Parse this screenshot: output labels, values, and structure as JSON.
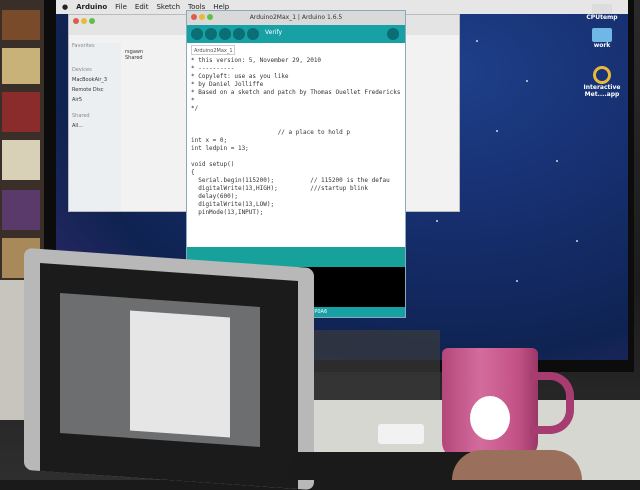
{
  "menubar": {
    "app": "Arduino",
    "items": [
      "File",
      "Edit",
      "Sketch",
      "Tools",
      "Help"
    ]
  },
  "finder": {
    "sidebar": [
      "Favorites",
      "Devices",
      "MacBookAir_3",
      "Remote Disc",
      "Air5",
      "Shared",
      "All..."
    ],
    "list": [
      "rsgawn",
      "Shared"
    ]
  },
  "arduino": {
    "title": "Arduino2Max_1 | Arduino 1.6.5",
    "verify_label": "Verify",
    "tab": "Arduino2Max_1",
    "code": "* this version: 5, November 29, 2010\n* ----------\n* Copyleft: use as you like\n* by Daniel Jolliffe\n* Based on a sketch and patch by Thomas Ouellet Fredericks\n*\n*/\n\n\n                        // a place to hold p\nint x = 0;\nint ledpin = 13;\n\nvoid setup()\n{\n  Serial.begin(115200);          // 115200 is the defau\n  digitalWrite(13,HIGH);         ///startup blink\n  delay(600);\n  digitalWrite(13,LOW);\n  pinMode(13,INPUT);",
    "status": "ino Nano, ATmega328 on /dev/cu.usbserial-1BQNP0A6"
  },
  "desktop_icons": [
    "CPUtemp",
    "work",
    "Interactive Met....app"
  ],
  "colors": {
    "arduino_teal": "#17a1a5",
    "desktop_blue": "#152d6b",
    "mug_pink": "#c25184"
  }
}
